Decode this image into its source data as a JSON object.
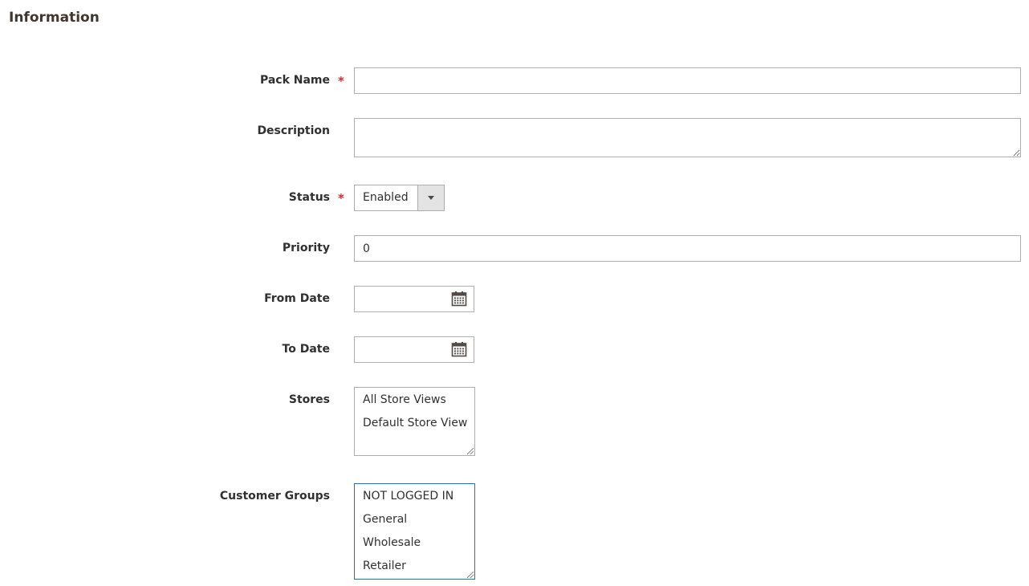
{
  "section": {
    "title": "Information"
  },
  "form": {
    "pack_name": {
      "label": "Pack Name",
      "required_mark": "*",
      "value": ""
    },
    "description": {
      "label": "Description",
      "value": ""
    },
    "status": {
      "label": "Status",
      "required_mark": "*",
      "value": "Enabled"
    },
    "priority": {
      "label": "Priority",
      "value": "0"
    },
    "from_date": {
      "label": "From Date",
      "value": "",
      "icon": "calendar-icon"
    },
    "to_date": {
      "label": "To Date",
      "value": "",
      "icon": "calendar-icon"
    },
    "stores": {
      "label": "Stores",
      "options": [
        "All Store Views",
        "Default Store View"
      ]
    },
    "customer_groups": {
      "label": "Customer Groups",
      "options": [
        "NOT LOGGED IN",
        "General",
        "Wholesale",
        "Retailer"
      ]
    }
  },
  "colors": {
    "required": "#e22626",
    "focus_border": "#007bdb",
    "border": "#adadad",
    "select_button_bg": "#e3e3e3"
  }
}
